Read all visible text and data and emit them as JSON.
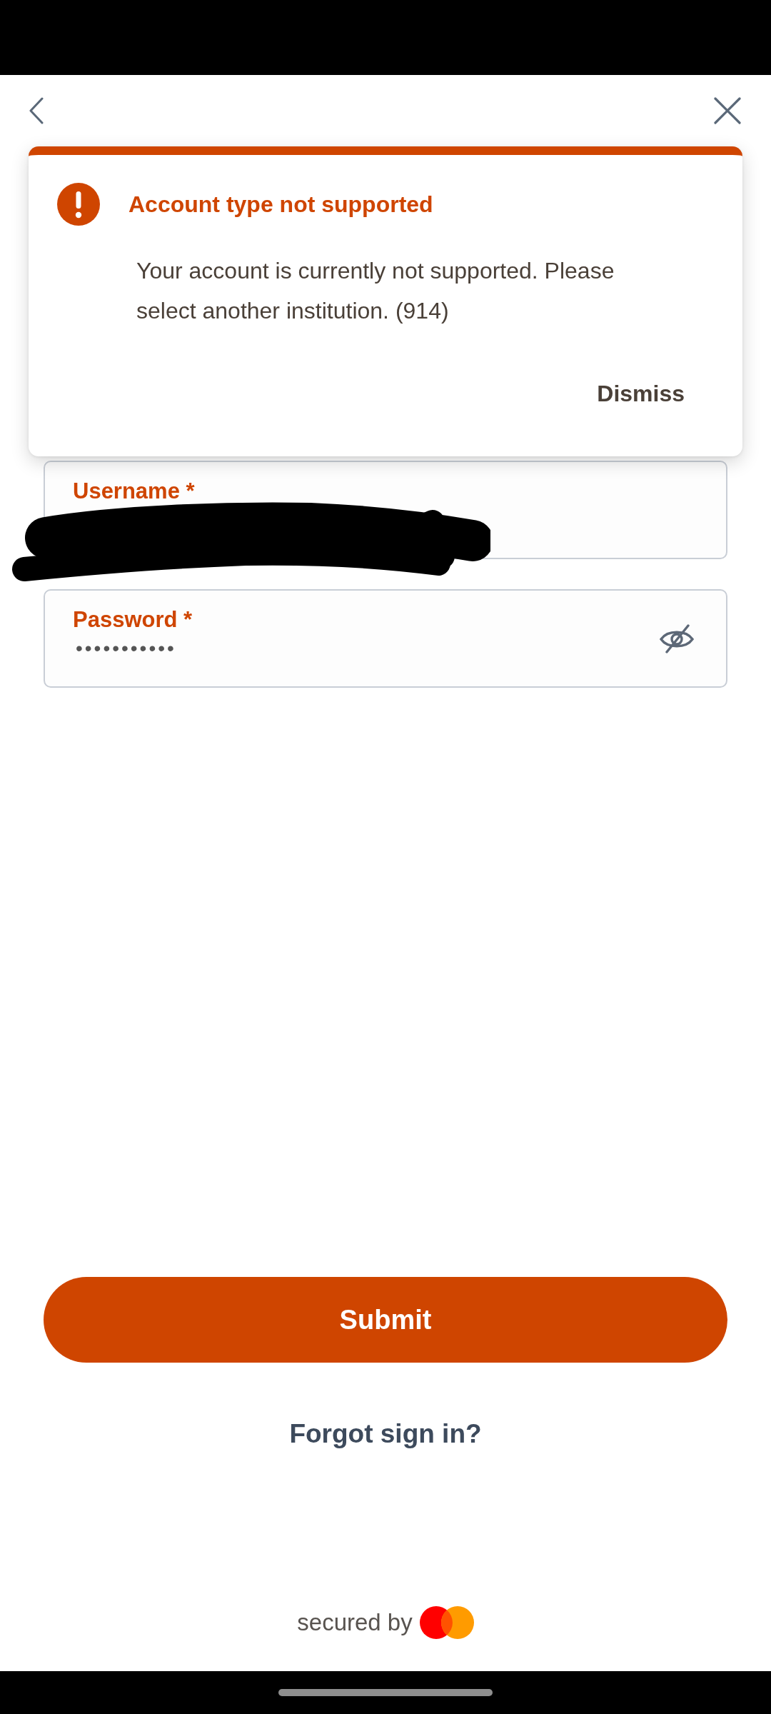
{
  "alert": {
    "kind": "error",
    "title": "Account type not supported",
    "message": "Your account is currently not supported. Please select another institution. (914)",
    "action": "Dismiss"
  },
  "fields": [
    {
      "kind": "text",
      "label": "Username *",
      "redacted": true
    },
    {
      "kind": "password",
      "label": "Password *",
      "value": "•••••••••••",
      "masked": true
    }
  ],
  "submit": "Submit",
  "forgot_link": "Forgot sign in?",
  "footer": {
    "text": "secured by"
  }
}
